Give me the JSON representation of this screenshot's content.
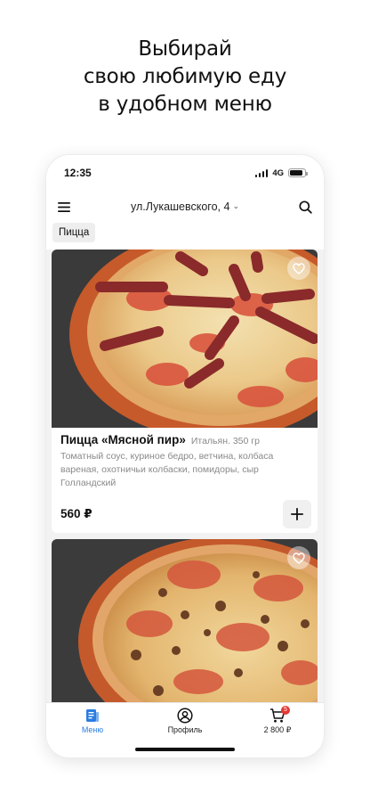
{
  "headline": [
    "Выбирай",
    "свою любимую еду",
    "в удобном меню"
  ],
  "status_bar": {
    "time": "12:35",
    "network": "4G",
    "battery_level": 0.9
  },
  "topbar": {
    "address": "ул.Лукашевского, 4",
    "menu_icon": "hamburger-icon",
    "search_icon": "search-icon"
  },
  "category_chip": "Пицца",
  "products": [
    {
      "title": "Пицца «Мясной пир»",
      "meta": "Итальян. 350 гр",
      "description": "Томатный соус, куриное бедро, ветчина, колбаса вареная, охотничьи колбаски, помидоры, сыр Голландский",
      "price": "560 ₽",
      "favorite_icon": "heart-icon",
      "add_icon": "plus-icon"
    },
    {
      "favorite_icon": "heart-icon"
    }
  ],
  "tabbar": {
    "tabs": [
      {
        "label": "Меню",
        "icon": "menu-book-icon",
        "active": true
      },
      {
        "label": "Профиль",
        "icon": "profile-icon",
        "active": false
      },
      {
        "label": "2 800 ₽",
        "icon": "cart-icon",
        "badge": "5",
        "active": false
      }
    ]
  },
  "colors": {
    "accent": "#2a7de1",
    "badge": "#e53935",
    "background": "#f2f2f2"
  }
}
